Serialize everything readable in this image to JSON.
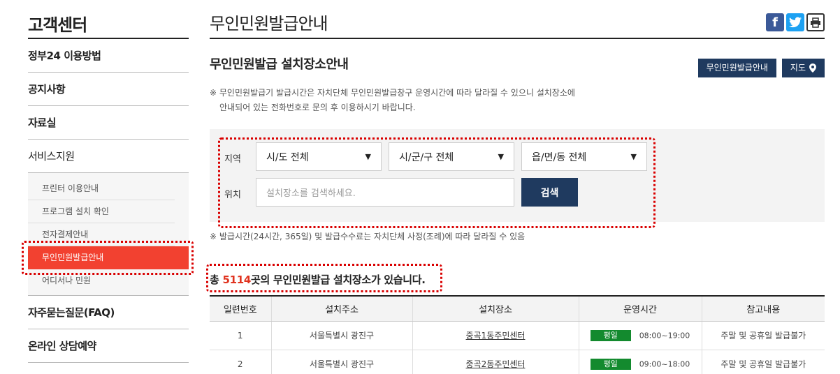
{
  "sidebar": {
    "title": "고객센터",
    "items": [
      {
        "label": "정부24 이용방법"
      },
      {
        "label": "공지사항"
      },
      {
        "label": "자료실"
      },
      {
        "label": "서비스지원"
      }
    ],
    "sub_items": [
      {
        "label": "프린터 이용안내"
      },
      {
        "label": "프로그램 설치 확인"
      },
      {
        "label": "전자결제안내"
      },
      {
        "label": "무인민원발급안내"
      },
      {
        "label": "어디서나 민원"
      }
    ],
    "bottom_items": [
      {
        "label": "자주묻는질문(FAQ)"
      },
      {
        "label": "온라인 상담예약"
      }
    ]
  },
  "main": {
    "page_title": "무인민원발급안내",
    "section_title": "무인민원발급 설치장소안내",
    "buttons": {
      "info": "무인민원발급안내",
      "map": "지도"
    },
    "notice1_line1": "※ 무인민원발급기 발급시간은 자치단체 무인민원발급창구 운영시간에 따라 달라질 수 있으니 설치장소에",
    "notice1_line2": "안내되어 있는 전화번호로 문의 후 이용하시기 바랍니다.",
    "search": {
      "region_label": "지역",
      "location_label": "위치",
      "sido": "시/도 전체",
      "sigungu": "시/군/구 전체",
      "eupmyeondong": "읍/면/동 전체",
      "placeholder": "설치장소를 검색하세요.",
      "button": "검색"
    },
    "notice2": "※ 발급시간(24시간, 365일) 및 발급수수료는 자치단체 사정(조례)에 따라 달라질 수 있음",
    "count": {
      "prefix": "총 ",
      "number": "5114",
      "suffix": "곳의 무인민원발급 설치장소가 있습니다."
    },
    "table": {
      "headers": [
        "일련번호",
        "설치주소",
        "설치장소",
        "운영시간",
        "참고내용"
      ],
      "rows": [
        {
          "no": "1",
          "address": "서울특별시 광진구",
          "place": "중곡1동주민센터",
          "badge": "평일",
          "time": "08:00~19:00",
          "note": "주말 및 공휴일 발급불가"
        },
        {
          "no": "2",
          "address": "서울특별시 광진구",
          "place": "중곡2동주민센터",
          "badge": "평일",
          "time": "09:00~18:00",
          "note": "주말 및 공휴일 발급불가"
        }
      ]
    }
  },
  "colors": {
    "accent": "#f24130",
    "navy": "#1f3a5f",
    "badge": "#138a2e",
    "highlight": "#d90000"
  }
}
